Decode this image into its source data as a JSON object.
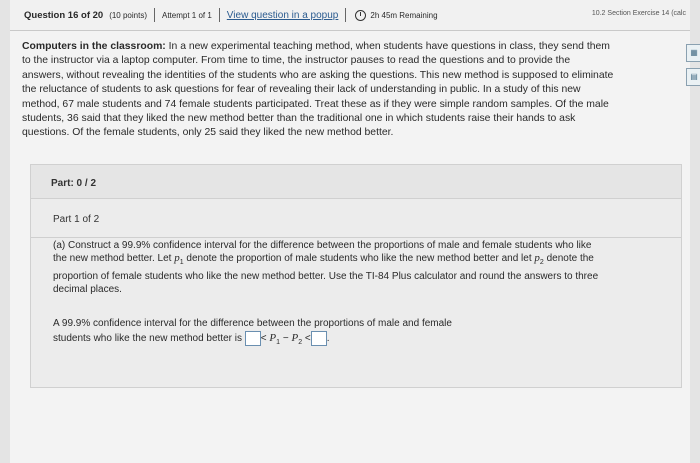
{
  "header": {
    "question": "Question 16 of 20",
    "points": "(10 points)",
    "attempt": "Attempt 1 of 1",
    "popup_link": "View question in a popup",
    "remaining": "2h 45m Remaining",
    "section": "10.2 Section Exercise 14 (calc"
  },
  "problem": {
    "title": "Computers in the classroom:",
    "line1": "In a new experimental teaching method, when students have questions in class, they send them",
    "line2": "to the instructor via a laptop computer. From time to time, the instructor pauses to read the questions and to provide the",
    "line3": "answers, without revealing the identities of the students who are asking the questions. This new method is supposed to eliminate",
    "line4": "the reluctance of students to ask questions for fear of revealing their lack of understanding in public. In a study of this new",
    "line5": "method, 67 male students and 74 female students participated. Treat these as if they were simple random samples. Of the male",
    "line6": "students, 36 said that they liked the new method better than the traditional one in which students raise their hands to ask",
    "line7": "questions. Of the female students, only 25 said they liked the new method better."
  },
  "part_status": {
    "label": "Part: 0 / 2"
  },
  "part": {
    "title": "Part 1 of 2",
    "a_line1": "(a) Construct a 99.9% confidence interval for the difference between the proportions of male and female students who like",
    "a_line2a": "the new method better. Let",
    "p1": "p",
    "sub1": "1",
    "a_line2b": "denote the proportion of male students who like the new method better and let",
    "p2": "p",
    "sub2": "2",
    "a_line2c": "denote the",
    "a_line3": "proportion of female students who like the new method better. Use the TI-84 Plus calculator and round the answers to three",
    "a_line4": "decimal places.",
    "ans_line1": "A 99.9% confidence interval for the difference between the proportions of male and female",
    "ans_line2": "students who like the new method better is",
    "lt1": "<",
    "expr": "P",
    "esub1": "1",
    "minus": "−",
    "expr2": "P",
    "esub2": "2",
    "lt2": "<",
    "period": "."
  }
}
